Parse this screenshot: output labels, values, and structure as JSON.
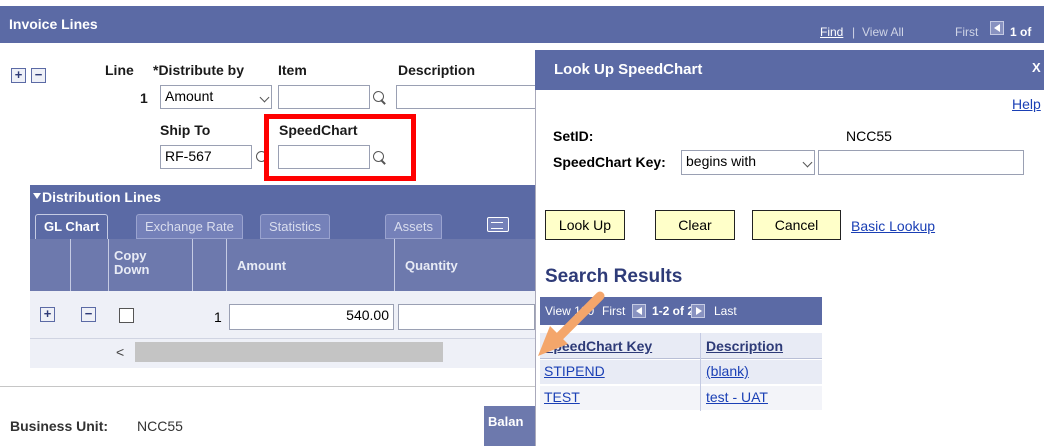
{
  "invoice": {
    "title": "Invoice Lines",
    "nav": {
      "find": "Find",
      "sep": "|",
      "view_all": "View All",
      "first": "First",
      "count": "1 of"
    },
    "labels": {
      "line": "Line",
      "distribute_by": "*Distribute by",
      "item": "Item",
      "description": "Description",
      "ship_to": "Ship To",
      "speedchart": "SpeedChart"
    },
    "values": {
      "line_number": "1",
      "distribute_by": "Amount",
      "ship_to": "RF-567"
    }
  },
  "distribution": {
    "title": "Distribution Lines",
    "tabs": [
      "GL Chart",
      "Exchange Rate",
      "Statistics",
      "Assets"
    ],
    "columns": {
      "copy_down": "Copy Down",
      "amount": "Amount",
      "quantity": "Quantity"
    },
    "row": {
      "number": "1",
      "amount": "540.00"
    },
    "scroll_left": "<"
  },
  "footer": {
    "business_unit_label": "Business Unit:",
    "business_unit_value": "NCC55",
    "balance_tab": "Balan"
  },
  "lookup": {
    "title": "Look Up SpeedChart",
    "close": "X",
    "help": "Help",
    "setid_label": "SetID:",
    "setid_value": "NCC55",
    "key_label": "SpeedChart Key:",
    "key_operator": "begins with",
    "key_value": "",
    "buttons": {
      "lookup": "Look Up",
      "clear": "Clear",
      "cancel": "Cancel",
      "basic": "Basic Lookup"
    },
    "results": {
      "title": "Search Results",
      "nav": {
        "view": "View 100",
        "first": "First",
        "range": "1-2 of 2",
        "last": "Last"
      },
      "columns": {
        "key": "SpeedChart Key",
        "description": "Description"
      },
      "rows": [
        {
          "key": "STIPEND",
          "description": "(blank)"
        },
        {
          "key": "TEST",
          "description": "test - UAT"
        }
      ]
    }
  },
  "colors": {
    "header_bg": "#5b6aa5",
    "button_bg": "#ffffc9",
    "highlight": "#ff0000",
    "arrow": "#f4a66b",
    "link": "#1a3fb5"
  }
}
